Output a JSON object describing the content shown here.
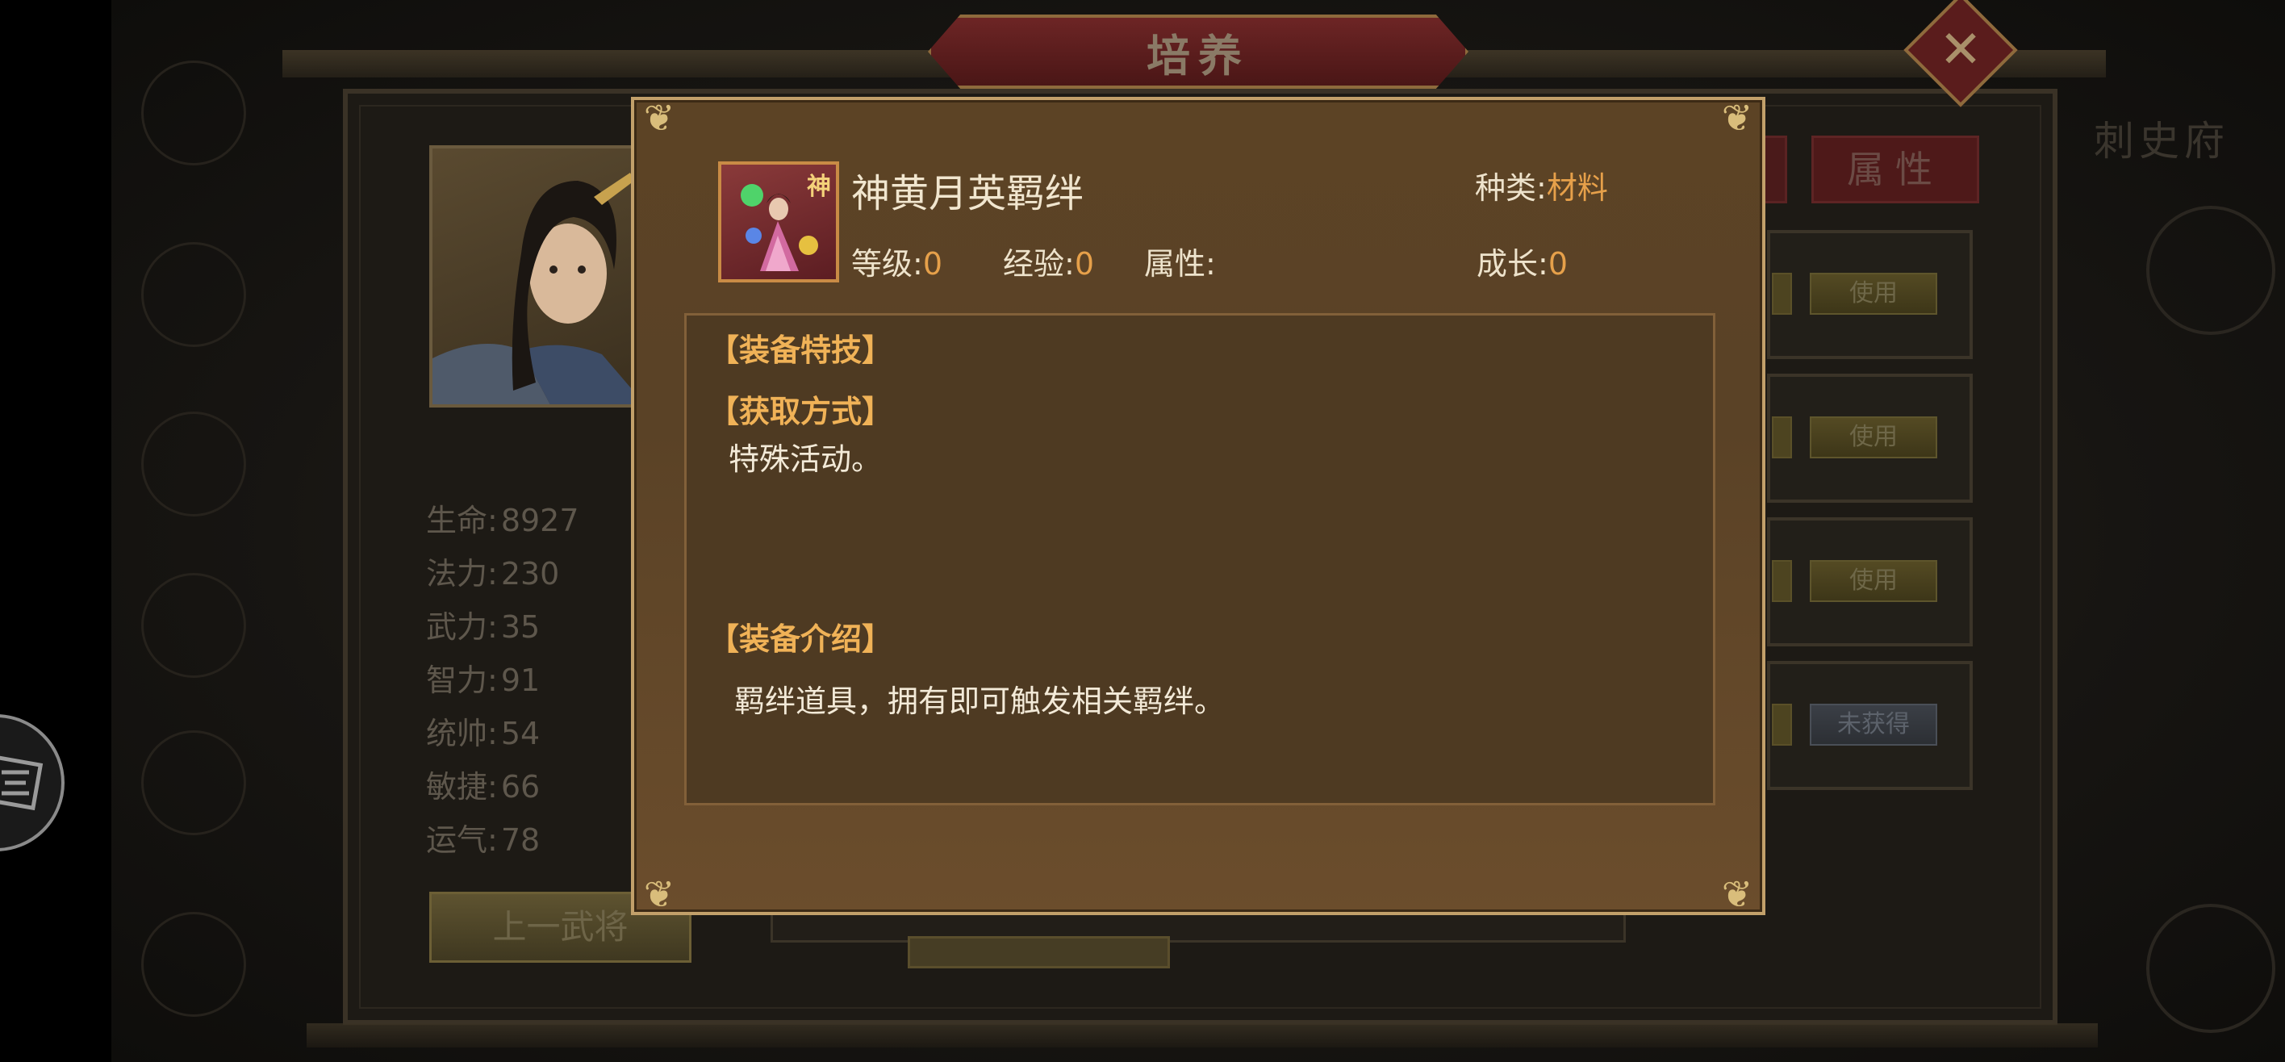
{
  "game": {
    "title": "培养",
    "close_symbol": "✕",
    "right_side_label": "刺史府",
    "tab_attributes": "属性",
    "prev_general_button": "上一武将",
    "stats": [
      {
        "label": "生命:",
        "value": "8927"
      },
      {
        "label": "法力:",
        "value": "230"
      },
      {
        "label": "武力:",
        "value": "35"
      },
      {
        "label": "智力:",
        "value": "91"
      },
      {
        "label": "统帅:",
        "value": "54"
      },
      {
        "label": "敏捷:",
        "value": "66"
      },
      {
        "label": "运气:",
        "value": "78"
      }
    ],
    "item_rows": [
      {
        "button": "使用"
      },
      {
        "button": "使用"
      },
      {
        "button": "使用"
      },
      {
        "button": "未获得"
      }
    ]
  },
  "dialog": {
    "item_name": "神黄月英羁绊",
    "icon_badge": "神",
    "type_label": "种类:",
    "type_value": "材料",
    "level_label": "等级:",
    "level_value": "0",
    "exp_label": "经验:",
    "exp_value": "0",
    "attr_label": "属性:",
    "growth_label": "成长:",
    "growth_value": "0",
    "section_skill": "【装备特技】",
    "section_obtain": "【获取方式】",
    "obtain_text": "特殊活动。",
    "section_intro": "【装备介绍】",
    "intro_text": "羁绊道具，拥有即可触发相关羁绊。"
  },
  "colors": {
    "dialog_bg": "#5c4325",
    "dialog_border": "#c2a06a",
    "section_heading": "#f0b257",
    "value_orange": "#e6a04a",
    "title_plate": "#6d2525"
  },
  "icons": [
    "float-ball-icon",
    "close-icon",
    "item-icon",
    "corner-ornament-icon"
  ]
}
